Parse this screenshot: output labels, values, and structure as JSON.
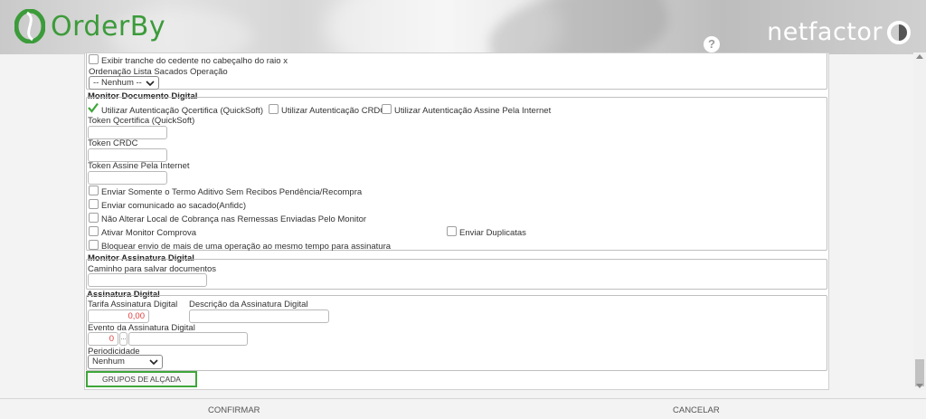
{
  "header": {
    "left_logo": "OrderBy",
    "right_logo": "netfactor",
    "help": "?"
  },
  "top_section": {
    "checkbox_tranche": "Exibir tranche do cedente no cabeçalho do raio x",
    "ordenacao_label": "Ordenação Lista Sacados Operação",
    "ordenacao_value": "-- Nenhum --"
  },
  "monitor_documento": {
    "title": "Monitor Documento Digital",
    "opt_qcertifica": "Utilizar Autenticação Qcertifica (QuickSoft)",
    "opt_crdc": "Utilizar Autenticação CRDC",
    "opt_assine": "Utilizar Autenticação Assine Pela Internet",
    "token_qcertifica_label": "Token Qcertifica (QuickSoft)",
    "token_crdc_label": "Token CRDC",
    "token_assine_label": "Token Assine Pela Internet",
    "cb_termo_aditivo": "Enviar Somente o Termo Aditivo Sem Recibos Pendência/Recompra",
    "cb_comunicado": "Enviar comunicado ao sacado(Anfidc)",
    "cb_nao_alterar": "Não Alterar Local de Cobrança nas Remessas Enviadas Pelo Monitor",
    "cb_ativar_comprova": "Ativar Monitor Comprova",
    "cb_enviar_duplicatas": "Enviar Duplicatas",
    "cb_bloquear": "Bloquear envio de mais de uma operação ao mesmo tempo para assinatura"
  },
  "monitor_assinatura": {
    "title": "Monitor Assinatura Digital",
    "caminho_label": "Caminho para salvar documentos"
  },
  "assinatura_digital": {
    "title": "Assinatura Digital",
    "tarifa_label": "Tarifa Assinatura Digital",
    "tarifa_value": "0,00",
    "descricao_label": "Descrição da Assinatura Digital",
    "evento_label": "Evento da Assinatura Digital",
    "evento_value": "0",
    "evento_lookup": "...",
    "periodicidade_label": "Periodicidade",
    "periodicidade_value": "Nenhum"
  },
  "buttons": {
    "grupos": "GRUPOS DE ALÇADA",
    "confirmar": "CONFIRMAR",
    "cancelar": "CANCELAR"
  },
  "colors": {
    "brand_green": "#3c9b3a",
    "tarifa_red": "#e03b3b"
  }
}
